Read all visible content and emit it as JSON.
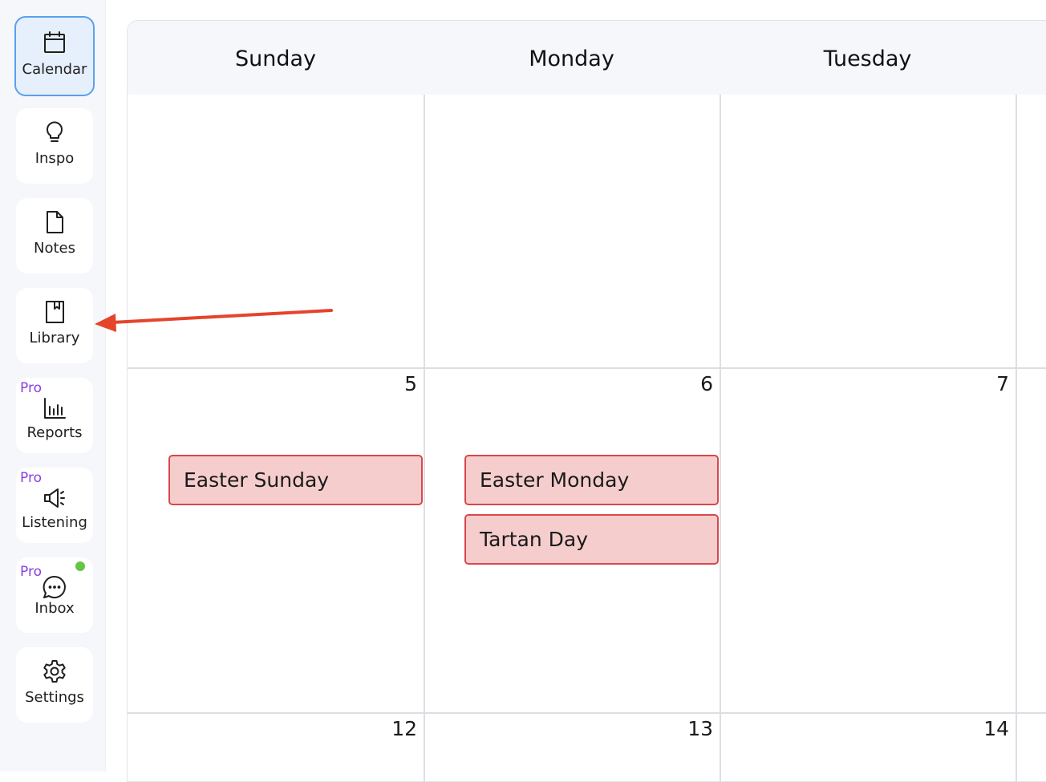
{
  "sidebar": {
    "items": [
      {
        "label": "Calendar",
        "icon": "calendar-icon",
        "active": true
      },
      {
        "label": "Inspo",
        "icon": "lightbulb-icon"
      },
      {
        "label": "Notes",
        "icon": "document-icon"
      },
      {
        "label": "Library",
        "icon": "bookmark-book-icon"
      },
      {
        "label": "Reports",
        "icon": "bar-chart-icon",
        "badge": "Pro"
      },
      {
        "label": "Listening",
        "icon": "megaphone-icon",
        "badge": "Pro"
      },
      {
        "label": "Inbox",
        "icon": "chat-bubble-icon",
        "badge": "Pro",
        "notification_dot": true
      },
      {
        "label": "Settings",
        "icon": "gear-icon"
      }
    ]
  },
  "calendar": {
    "days": [
      "Sunday",
      "Monday",
      "Tuesday"
    ],
    "weeks": [
      {
        "dates": [
          "",
          "",
          ""
        ]
      },
      {
        "dates": [
          "5",
          "6",
          "7"
        ]
      },
      {
        "dates": [
          "12",
          "13",
          "14"
        ]
      }
    ],
    "events": [
      {
        "title": "Easter Sunday",
        "date": "5"
      },
      {
        "title": "Easter Monday",
        "date": "6"
      },
      {
        "title": "Tartan Day",
        "date": "6"
      }
    ]
  },
  "colors": {
    "accent": "#5aa0ee",
    "active_bg": "#e6f0fc",
    "pro_badge": "#8a3ee0",
    "event_bg": "#f6cdcd",
    "event_border": "#d9474b",
    "notification_dot": "#65c544",
    "annotation_arrow": "#e5442b"
  }
}
